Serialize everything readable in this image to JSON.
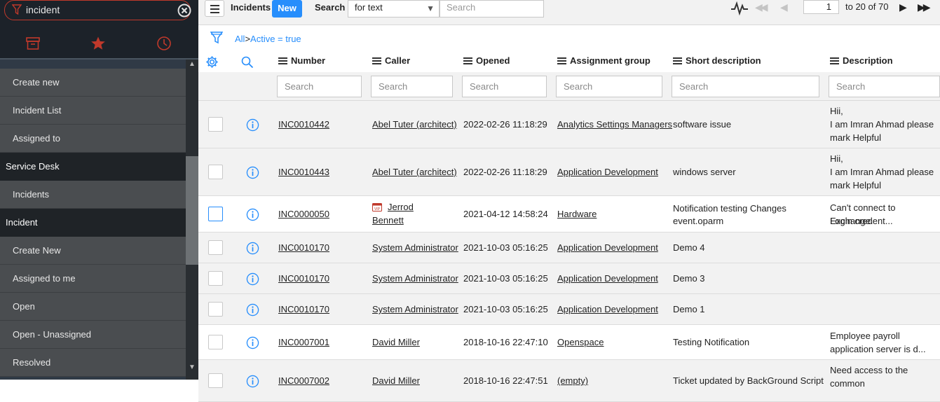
{
  "nav": {
    "filter_text": "incident",
    "items": [
      {
        "type": "item",
        "label": "Create new"
      },
      {
        "type": "item",
        "label": "Incident List"
      },
      {
        "type": "item",
        "label": "Assigned to"
      },
      {
        "type": "section",
        "label": "Service Desk"
      },
      {
        "type": "item",
        "label": "Incidents"
      },
      {
        "type": "section",
        "label": "Incident"
      },
      {
        "type": "item",
        "label": "Create New"
      },
      {
        "type": "item",
        "label": "Assigned to me"
      },
      {
        "type": "item",
        "label": "Open"
      },
      {
        "type": "item",
        "label": "Open - Unassigned"
      },
      {
        "type": "item",
        "label": "Resolved"
      }
    ],
    "tabs": [
      "archive-icon",
      "star-icon",
      "clock-icon"
    ],
    "accent": "#c0392b"
  },
  "toolbar": {
    "title": "Incidents",
    "new_label": "New",
    "search_label": "Search",
    "search_field": "for text",
    "search_placeholder": "Search",
    "page": "1",
    "range": "to 20 of 70"
  },
  "breadcrumb": {
    "all": "All",
    "separator": ">",
    "condition": "Active = true"
  },
  "table": {
    "columns": [
      "Number",
      "Caller",
      "Opened",
      "Assignment group",
      "Short description",
      "Description"
    ],
    "search_placeholder": "Search",
    "rows": [
      {
        "number": "INC0010442",
        "caller": "Abel Tuter (architect)",
        "opened": "2022-02-26 11:18:29",
        "group": "Analytics Settings Managers",
        "short": "software issue",
        "desc": [
          "Hii,",
          "I am Imran Ahmad please",
          "mark Helpful"
        ]
      },
      {
        "number": "INC0010443",
        "caller": "Abel Tuter (architect)",
        "opened": "2022-02-26 11:18:29",
        "group": "Application Development",
        "short": "windows server",
        "desc": [
          "Hii,",
          "I am Imran Ahmad please",
          "mark Helpful"
        ]
      },
      {
        "number": "INC0000050",
        "caller": [
          "Jerrod",
          "Bennett"
        ],
        "caller_badge": "VIP",
        "opened": "2021-04-12 14:58:24",
        "group": "Hardware",
        "short": [
          "Notification testing Changes",
          "event.oparm"
        ],
        "desc": [
          "Can't connect to Exchange.",
          "Login credent..."
        ]
      },
      {
        "number": "INC0010170",
        "caller": "System Administrator",
        "opened": "2021-10-03 05:16:25",
        "group": "Application Development",
        "short": "Demo 4",
        "desc": []
      },
      {
        "number": "INC0010170",
        "caller": "System Administrator",
        "opened": "2021-10-03 05:16:25",
        "group": "Application Development",
        "short": "Demo 3",
        "desc": []
      },
      {
        "number": "INC0010170",
        "caller": "System Administrator",
        "opened": "2021-10-03 05:16:25",
        "group": "Application Development",
        "short": "Demo 1",
        "desc": []
      },
      {
        "number": "INC0007001",
        "caller": "David Miller",
        "opened": "2018-10-16 22:47:10",
        "group": "Openspace",
        "short": "Testing Notification",
        "desc": [
          "Employee payroll",
          "application server is d..."
        ]
      },
      {
        "number": "INC0007002",
        "caller": "David Miller",
        "opened": "2018-10-16 22:47:51",
        "group": "(empty)",
        "short": "Ticket updated by BackGround Script",
        "desc": [
          "Need access to the common"
        ]
      }
    ]
  },
  "colors": {
    "link": "#278efc",
    "nav_bg": "#4a4d50"
  }
}
